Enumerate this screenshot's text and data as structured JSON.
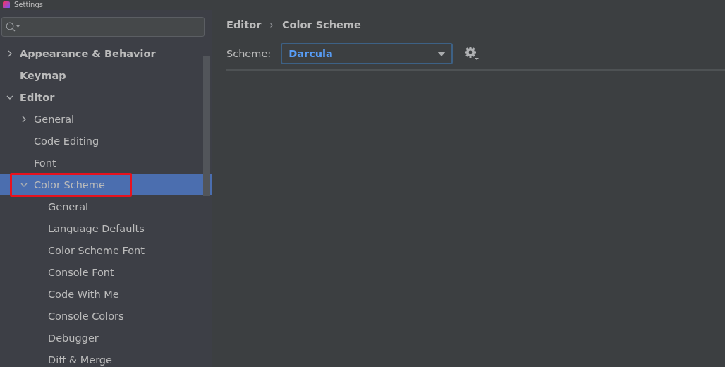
{
  "window": {
    "title": "Settings"
  },
  "sidebar": {
    "tree": [
      {
        "label": "Appearance & Behavior",
        "bold": true,
        "expanded": false,
        "selected": false,
        "highlighted": false
      },
      {
        "label": "Keymap",
        "bold": true,
        "selected": false,
        "highlighted": false
      },
      {
        "label": "Editor",
        "bold": true,
        "expanded": true,
        "selected": false,
        "highlighted": false,
        "children": [
          {
            "label": "General",
            "bold": false,
            "expanded": false,
            "selected": false,
            "highlighted": false
          },
          {
            "label": "Code Editing",
            "bold": false,
            "selected": false,
            "highlighted": false
          },
          {
            "label": "Font",
            "bold": false,
            "selected": false,
            "highlighted": false
          },
          {
            "label": "Color Scheme",
            "bold": false,
            "expanded": true,
            "selected": true,
            "highlighted": true,
            "children": [
              {
                "label": "General",
                "bold": false,
                "selected": false,
                "highlighted": false
              },
              {
                "label": "Language Defaults",
                "bold": false,
                "selected": false,
                "highlighted": false
              },
              {
                "label": "Color Scheme Font",
                "bold": false,
                "selected": false,
                "highlighted": false
              },
              {
                "label": "Console Font",
                "bold": false,
                "selected": false,
                "highlighted": false
              },
              {
                "label": "Code With Me",
                "bold": false,
                "selected": false,
                "highlighted": false
              },
              {
                "label": "Console Colors",
                "bold": false,
                "selected": false,
                "highlighted": false
              },
              {
                "label": "Debugger",
                "bold": false,
                "selected": false,
                "highlighted": false
              },
              {
                "label": "Diff & Merge",
                "bold": false,
                "selected": false,
                "highlighted": false
              }
            ]
          }
        ]
      }
    ]
  },
  "breadcrumb": {
    "items": [
      "Editor",
      "Color Scheme"
    ],
    "separator": "›"
  },
  "scheme": {
    "label": "Scheme:",
    "value": "Darcula",
    "focused": true
  }
}
